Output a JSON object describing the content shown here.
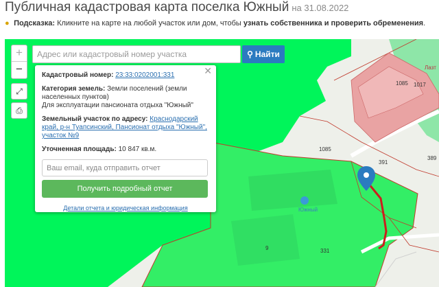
{
  "header": {
    "title": "Публичная кадастровая карта поселка Южный",
    "date": "на 31.08.2022"
  },
  "hint": {
    "label": "Подсказка:",
    "text": "Кликните на карте на любой участок или дом, чтобы",
    "bold": "узнать собственника и проверить обременения",
    "end": "."
  },
  "map": {
    "zoom_in": "+",
    "zoom_out": "−",
    "search": {
      "placeholder": "Адрес или кадастровый номер участка",
      "button": "Найти"
    },
    "labels": {
      "n1085a": "1085",
      "n1017": "1017",
      "n1085b": "1085",
      "n391": "391",
      "n389": "389",
      "n9": "9",
      "n331": "331",
      "yuzhny": "Южный",
      "lazt": "Лазт"
    },
    "colors": {
      "parcel": "#00f55a",
      "selected": "#33ee66",
      "building": "#e9a3a3",
      "route": "#cc1e1e",
      "pin": "#2b7bc0"
    }
  },
  "popup": {
    "cadastral_label": "Кадастровый номер:",
    "cadastral_value": "23:33:0202001:331",
    "category_label": "Категория земель:",
    "category_value": "Земли поселений (земли населенных пунктов)",
    "usage": "Для эксплуатации пансионата отдыха \"Южный\"",
    "address_label": "Земельный участок по адресу:",
    "address_value": "Краснодарский край, р-н Туапсинский, Пансионат отдыха \"Южный\", участок №9",
    "area_label": "Уточненная площадь:",
    "area_value": "10 847 кв.м.",
    "email_placeholder": "Ваш email, куда отправить отчет",
    "report_button": "Получить подробный отчет",
    "details_link": "Детали отчета и юридическая информация"
  }
}
